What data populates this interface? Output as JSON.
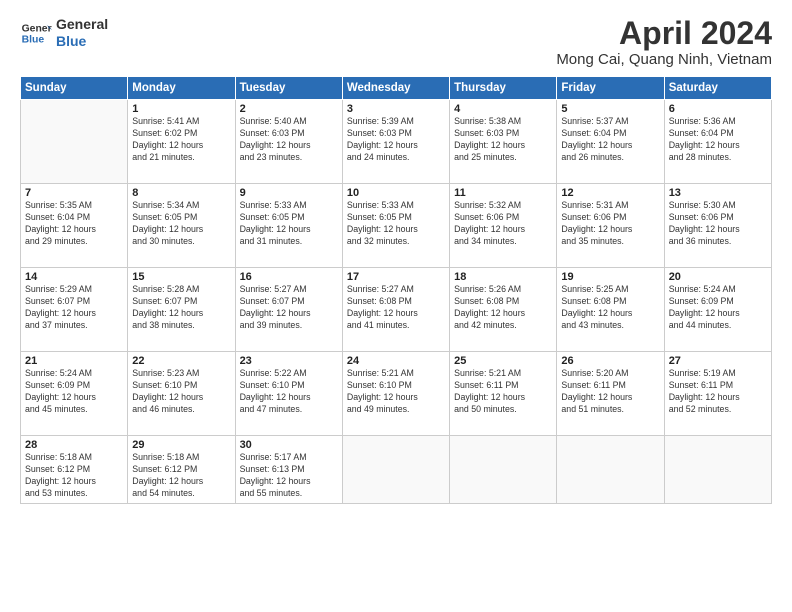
{
  "logo": {
    "line1": "General",
    "line2": "Blue"
  },
  "title": "April 2024",
  "subtitle": "Mong Cai, Quang Ninh, Vietnam",
  "days_of_week": [
    "Sunday",
    "Monday",
    "Tuesday",
    "Wednesday",
    "Thursday",
    "Friday",
    "Saturday"
  ],
  "weeks": [
    [
      {
        "num": "",
        "info": ""
      },
      {
        "num": "1",
        "info": "Sunrise: 5:41 AM\nSunset: 6:02 PM\nDaylight: 12 hours\nand 21 minutes."
      },
      {
        "num": "2",
        "info": "Sunrise: 5:40 AM\nSunset: 6:03 PM\nDaylight: 12 hours\nand 23 minutes."
      },
      {
        "num": "3",
        "info": "Sunrise: 5:39 AM\nSunset: 6:03 PM\nDaylight: 12 hours\nand 24 minutes."
      },
      {
        "num": "4",
        "info": "Sunrise: 5:38 AM\nSunset: 6:03 PM\nDaylight: 12 hours\nand 25 minutes."
      },
      {
        "num": "5",
        "info": "Sunrise: 5:37 AM\nSunset: 6:04 PM\nDaylight: 12 hours\nand 26 minutes."
      },
      {
        "num": "6",
        "info": "Sunrise: 5:36 AM\nSunset: 6:04 PM\nDaylight: 12 hours\nand 28 minutes."
      }
    ],
    [
      {
        "num": "7",
        "info": "Sunrise: 5:35 AM\nSunset: 6:04 PM\nDaylight: 12 hours\nand 29 minutes."
      },
      {
        "num": "8",
        "info": "Sunrise: 5:34 AM\nSunset: 6:05 PM\nDaylight: 12 hours\nand 30 minutes."
      },
      {
        "num": "9",
        "info": "Sunrise: 5:33 AM\nSunset: 6:05 PM\nDaylight: 12 hours\nand 31 minutes."
      },
      {
        "num": "10",
        "info": "Sunrise: 5:33 AM\nSunset: 6:05 PM\nDaylight: 12 hours\nand 32 minutes."
      },
      {
        "num": "11",
        "info": "Sunrise: 5:32 AM\nSunset: 6:06 PM\nDaylight: 12 hours\nand 34 minutes."
      },
      {
        "num": "12",
        "info": "Sunrise: 5:31 AM\nSunset: 6:06 PM\nDaylight: 12 hours\nand 35 minutes."
      },
      {
        "num": "13",
        "info": "Sunrise: 5:30 AM\nSunset: 6:06 PM\nDaylight: 12 hours\nand 36 minutes."
      }
    ],
    [
      {
        "num": "14",
        "info": "Sunrise: 5:29 AM\nSunset: 6:07 PM\nDaylight: 12 hours\nand 37 minutes."
      },
      {
        "num": "15",
        "info": "Sunrise: 5:28 AM\nSunset: 6:07 PM\nDaylight: 12 hours\nand 38 minutes."
      },
      {
        "num": "16",
        "info": "Sunrise: 5:27 AM\nSunset: 6:07 PM\nDaylight: 12 hours\nand 39 minutes."
      },
      {
        "num": "17",
        "info": "Sunrise: 5:27 AM\nSunset: 6:08 PM\nDaylight: 12 hours\nand 41 minutes."
      },
      {
        "num": "18",
        "info": "Sunrise: 5:26 AM\nSunset: 6:08 PM\nDaylight: 12 hours\nand 42 minutes."
      },
      {
        "num": "19",
        "info": "Sunrise: 5:25 AM\nSunset: 6:08 PM\nDaylight: 12 hours\nand 43 minutes."
      },
      {
        "num": "20",
        "info": "Sunrise: 5:24 AM\nSunset: 6:09 PM\nDaylight: 12 hours\nand 44 minutes."
      }
    ],
    [
      {
        "num": "21",
        "info": "Sunrise: 5:24 AM\nSunset: 6:09 PM\nDaylight: 12 hours\nand 45 minutes."
      },
      {
        "num": "22",
        "info": "Sunrise: 5:23 AM\nSunset: 6:10 PM\nDaylight: 12 hours\nand 46 minutes."
      },
      {
        "num": "23",
        "info": "Sunrise: 5:22 AM\nSunset: 6:10 PM\nDaylight: 12 hours\nand 47 minutes."
      },
      {
        "num": "24",
        "info": "Sunrise: 5:21 AM\nSunset: 6:10 PM\nDaylight: 12 hours\nand 49 minutes."
      },
      {
        "num": "25",
        "info": "Sunrise: 5:21 AM\nSunset: 6:11 PM\nDaylight: 12 hours\nand 50 minutes."
      },
      {
        "num": "26",
        "info": "Sunrise: 5:20 AM\nSunset: 6:11 PM\nDaylight: 12 hours\nand 51 minutes."
      },
      {
        "num": "27",
        "info": "Sunrise: 5:19 AM\nSunset: 6:11 PM\nDaylight: 12 hours\nand 52 minutes."
      }
    ],
    [
      {
        "num": "28",
        "info": "Sunrise: 5:18 AM\nSunset: 6:12 PM\nDaylight: 12 hours\nand 53 minutes."
      },
      {
        "num": "29",
        "info": "Sunrise: 5:18 AM\nSunset: 6:12 PM\nDaylight: 12 hours\nand 54 minutes."
      },
      {
        "num": "30",
        "info": "Sunrise: 5:17 AM\nSunset: 6:13 PM\nDaylight: 12 hours\nand 55 minutes."
      },
      {
        "num": "",
        "info": ""
      },
      {
        "num": "",
        "info": ""
      },
      {
        "num": "",
        "info": ""
      },
      {
        "num": "",
        "info": ""
      }
    ]
  ]
}
